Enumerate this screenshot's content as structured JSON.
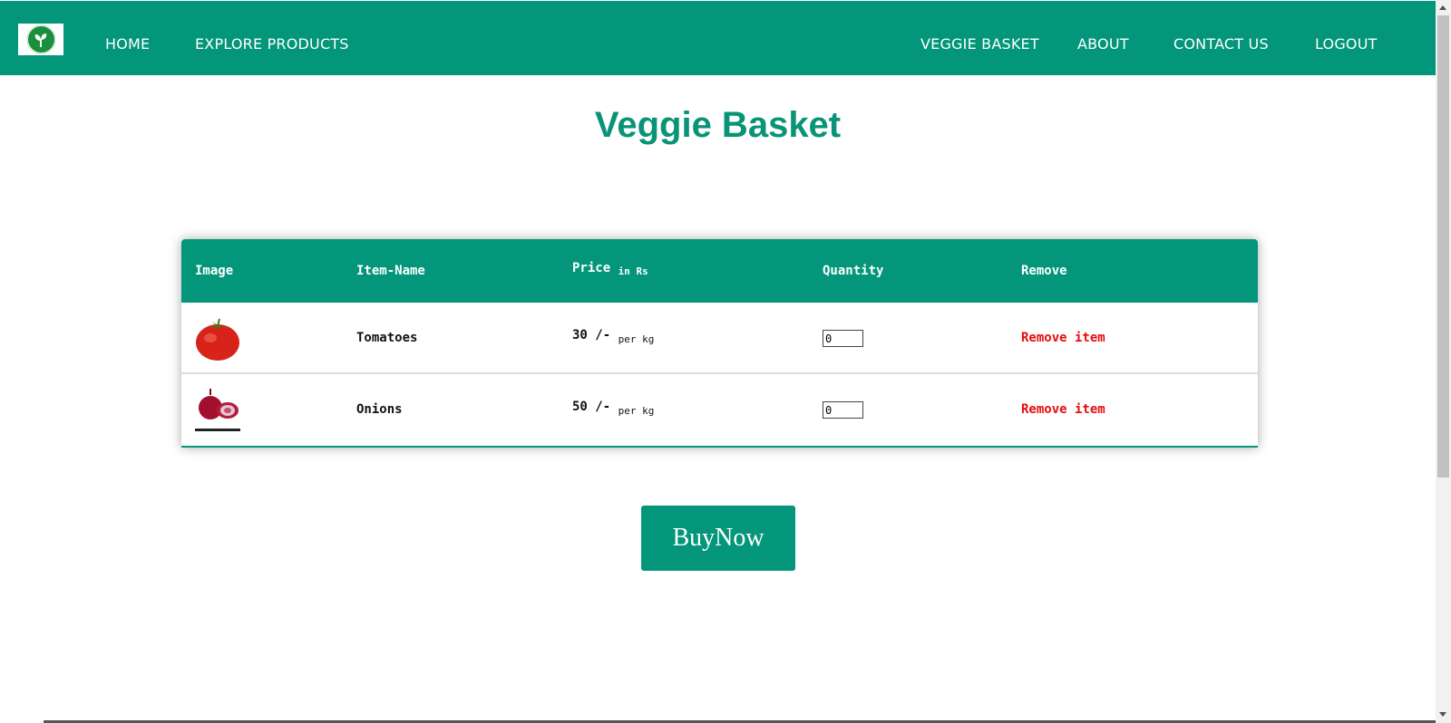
{
  "brand": {
    "logo_icon": "leaf-logo-icon",
    "colors": {
      "primary": "#03967a",
      "danger": "#e80b0b"
    }
  },
  "nav": {
    "home": "HOME",
    "explore": "EXPLORE PRODUCTS",
    "basket": "VEGGIE BASKET",
    "about": "ABOUT",
    "contact": "CONTACT US",
    "logout": "LOGOUT"
  },
  "page": {
    "title": "Veggie Basket"
  },
  "cart": {
    "headers": {
      "image": "Image",
      "item_name": "Item-Name",
      "price": "Price",
      "price_unit": "in Rs",
      "quantity": "Quantity",
      "remove": "Remove"
    },
    "items": [
      {
        "image_icon": "tomato-image",
        "name": "Tomatoes",
        "price": "30 /-",
        "price_unit": "per kg",
        "quantity": "0",
        "remove_label": "Remove item"
      },
      {
        "image_icon": "onion-image",
        "name": "Onions",
        "price": "50 /-",
        "price_unit": "per kg",
        "quantity": "0",
        "remove_label": "Remove item"
      }
    ]
  },
  "actions": {
    "buy_now": "BuyNow"
  }
}
